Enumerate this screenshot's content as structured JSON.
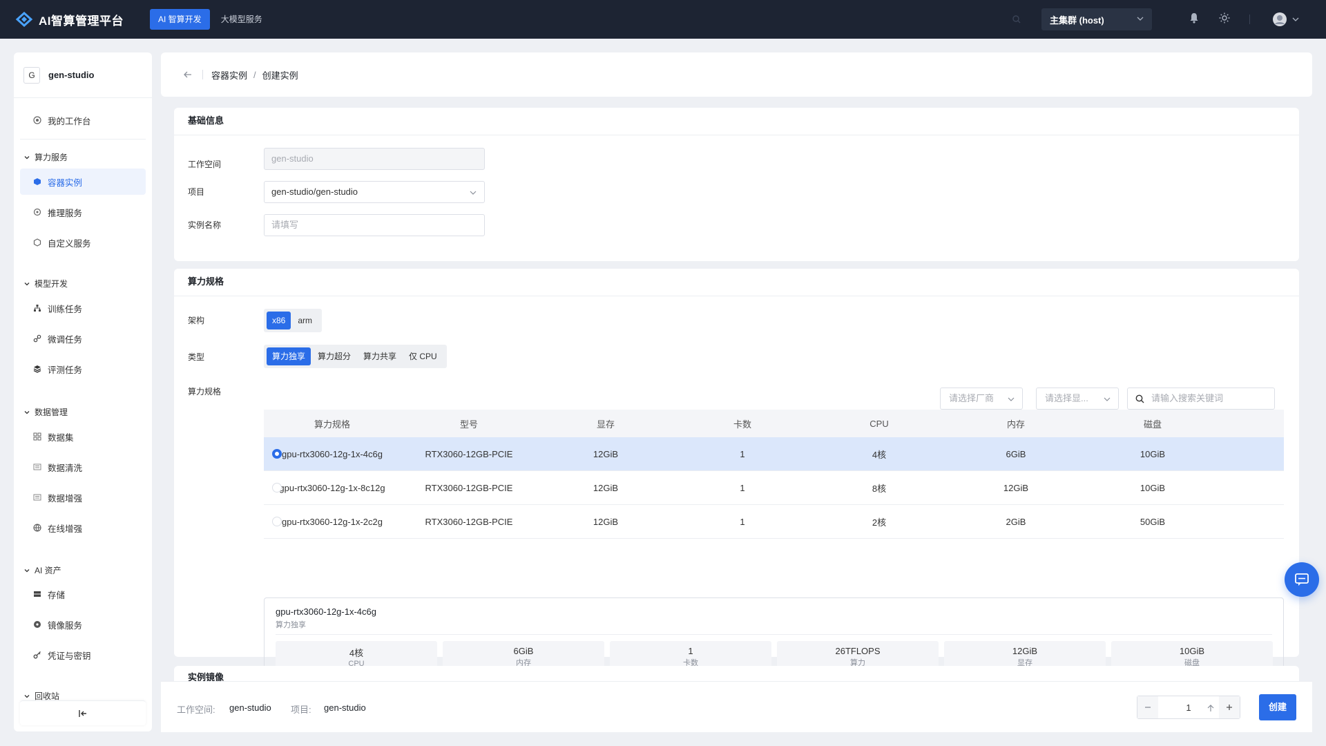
{
  "app": {
    "title": "AI智算管理平台"
  },
  "topnav": {
    "tabs": [
      {
        "label": "AI 智算开发",
        "active": true
      },
      {
        "label": "大模型服务",
        "active": false
      }
    ]
  },
  "cluster": {
    "label": "主集群 (host)"
  },
  "sidebar": {
    "workspace_badge": "G",
    "workspace_name": "gen-studio",
    "my_workbench": "我的工作台",
    "groups": {
      "compute": "算力服务",
      "model": "模型开发",
      "data": "数据管理",
      "assets": "AI 资产",
      "recycle": "回收站"
    },
    "items": {
      "containers": "容器实例",
      "inference": "推理服务",
      "custom": "自定义服务",
      "training": "训练任务",
      "finetune": "微调任务",
      "eval": "评测任务",
      "datasets": "数据集",
      "cleaning": "数据清洗",
      "augment": "数据增强",
      "online_aug": "在线增强",
      "storage": "存储",
      "images": "镜像服务",
      "credentials": "凭证与密钥"
    }
  },
  "breadcrumb": {
    "parent": "容器实例",
    "sep": "/",
    "current": "创建实例"
  },
  "basic": {
    "title": "基础信息",
    "workspace_label": "工作空间",
    "workspace_value": "gen-studio",
    "project_label": "项目",
    "project_value": "gen-studio/gen-studio",
    "name_label": "实例名称",
    "name_placeholder": "请填写"
  },
  "spec": {
    "title": "算力规格",
    "arch_label": "架构",
    "arch_options": [
      "x86",
      "arm"
    ],
    "type_label": "类型",
    "type_options": [
      "算力独享",
      "算力超分",
      "算力共享",
      "仅 CPU"
    ],
    "spec_label": "算力规格",
    "vendor_placeholder": "请选择厂商",
    "memory_placeholder": "请选择显...",
    "search_placeholder": "请输入搜索关键词",
    "columns": [
      "算力规格",
      "型号",
      "显存",
      "卡数",
      "CPU",
      "内存",
      "磁盘"
    ],
    "rows": [
      {
        "cells": [
          "gpu-rtx3060-12g-1x-4c6g",
          "RTX3060-12GB-PCIE",
          "12GiB",
          "1",
          "4核",
          "6GiB",
          "10GiB"
        ],
        "selected": true
      },
      {
        "cells": [
          "gpu-rtx3060-12g-1x-8c12g",
          "RTX3060-12GB-PCIE",
          "12GiB",
          "1",
          "8核",
          "12GiB",
          "10GiB"
        ],
        "selected": false
      },
      {
        "cells": [
          "gpu-rtx3060-12g-1x-2c2g",
          "RTX3060-12GB-PCIE",
          "12GiB",
          "1",
          "2核",
          "2GiB",
          "50GiB"
        ],
        "selected": false
      }
    ],
    "detail": {
      "name": "gpu-rtx3060-12g-1x-4c6g",
      "type": "算力独享",
      "metrics": [
        {
          "value": "4核",
          "label": "CPU"
        },
        {
          "value": "6GiB",
          "label": "内存"
        },
        {
          "value": "1",
          "label": "卡数"
        },
        {
          "value": "26TFLOPS",
          "label": "算力"
        },
        {
          "value": "12GiB",
          "label": "显存"
        },
        {
          "value": "10GiB",
          "label": "磁盘"
        }
      ]
    }
  },
  "image_section": {
    "title": "实例镜像"
  },
  "footer": {
    "workspace_label": "工作空间:",
    "workspace_value": "gen-studio",
    "project_label": "项目:",
    "project_value": "gen-studio",
    "quantity": "1",
    "create_label": "创建"
  },
  "colors": {
    "accent": "#2b6de8",
    "topbar": "#1d2433"
  }
}
